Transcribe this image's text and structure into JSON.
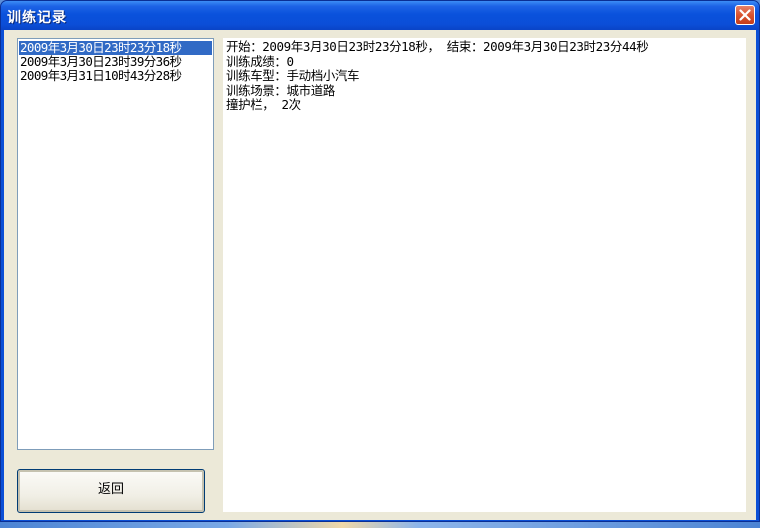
{
  "window": {
    "title": "训练记录",
    "close_icon": "close-icon"
  },
  "records": [
    {
      "label": "2009年3月30日23时23分18秒",
      "selected": true
    },
    {
      "label": "2009年3月30日23时39分36秒",
      "selected": false
    },
    {
      "label": "2009年3月31日10时43分28秒",
      "selected": false
    }
  ],
  "detail": {
    "lines": [
      "开始：2009年3月30日23时23分18秒， 结束：2009年3月30日23时23分44秒",
      "训练成绩：0",
      "训练车型：手动档小汽车",
      "训练场景：城市道路",
      "撞护栏， 2次"
    ]
  },
  "buttons": {
    "return_label": "返回"
  },
  "colors": {
    "title_bar": "#0b4fd6",
    "selection": "#316ac5",
    "dialog_background": "#ece9d8"
  }
}
